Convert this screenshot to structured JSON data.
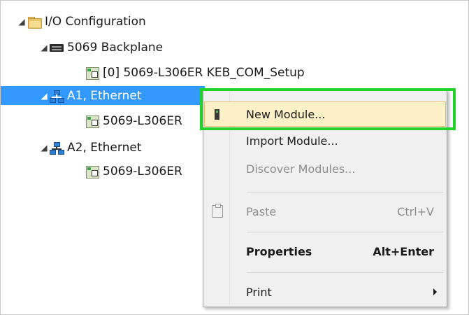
{
  "tree": {
    "items": [
      {
        "label": "I/O Configuration",
        "icon": "folder-icon"
      },
      {
        "label": "5069 Backplane",
        "icon": "backplane-icon"
      },
      {
        "label": "[0] 5069-L306ER KEB_COM_Setup",
        "icon": "module-icon"
      },
      {
        "label": "A1, Ethernet",
        "icon": "network-icon"
      },
      {
        "label": "5069-L306ER",
        "icon": "module-icon"
      },
      {
        "label": "A2, Ethernet",
        "icon": "network-icon"
      },
      {
        "label": "5069-L306ER",
        "icon": "module-icon"
      }
    ],
    "expand_glyph": "◢"
  },
  "context_menu": {
    "items": {
      "new_module": {
        "label": "New Module..."
      },
      "import_module": {
        "label": "Import Module..."
      },
      "discover_modules": {
        "label": "Discover Modules..."
      },
      "paste": {
        "label": "Paste",
        "shortcut": "Ctrl+V"
      },
      "properties": {
        "label": "Properties",
        "shortcut": "Alt+Enter"
      },
      "print": {
        "label": "Print"
      }
    }
  },
  "colors": {
    "selection": "#3399ff",
    "menu_highlight": "#fcf0c6",
    "annotation_box": "#22d12a"
  }
}
